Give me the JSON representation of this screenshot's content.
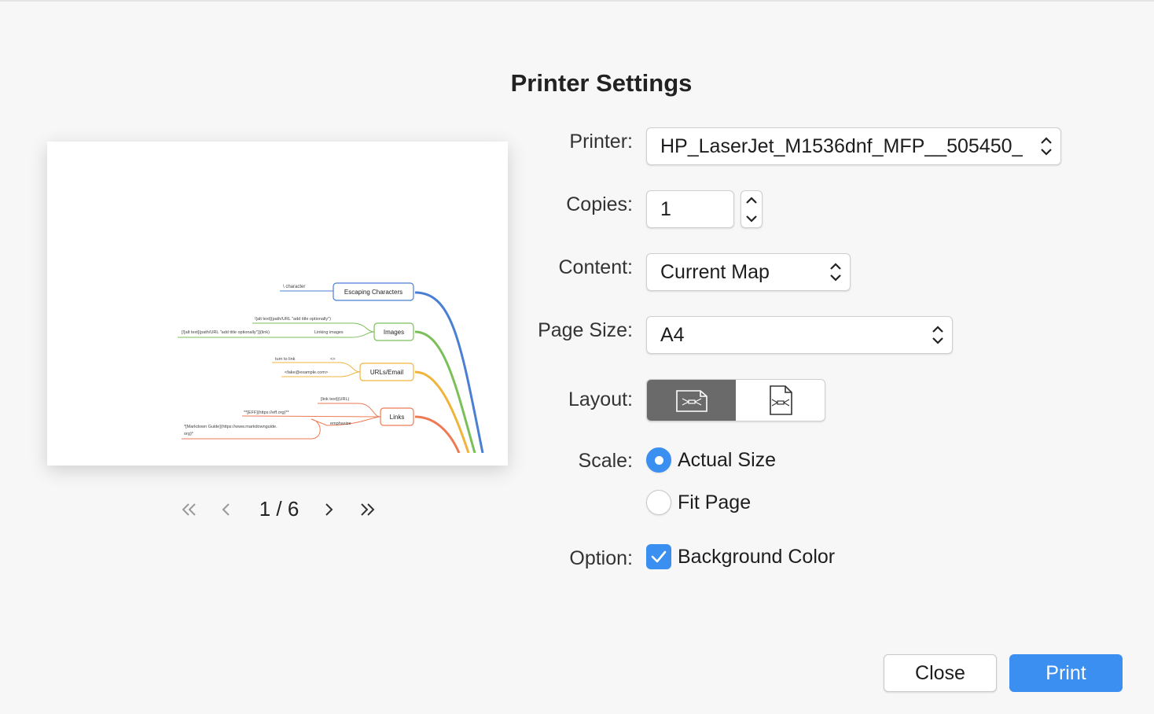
{
  "dialog": {
    "title": "Printer Settings"
  },
  "preview": {
    "nodes": {
      "escaping": "Escaping Characters",
      "images": "Images",
      "urls": "URLs/Email",
      "links": "Links"
    },
    "leaves": {
      "backslash": "\\ character",
      "img_alt": "![alt text](path/URL \"add title optionally\")",
      "img_link": "[![alt text](path/URL \"add title optionally\")](link)",
      "linking_images": "Linking images",
      "turn_to_link": "turn to link",
      "angle": "<>",
      "email": "<fake@example.com>",
      "link_text": "[link text](URL)",
      "eff": "**[EFF](https://eff.org)**",
      "emphasize": "emphasize",
      "md_guide_1": "*[Markdown Guide](https://www.markdownguide.",
      "md_guide_2": "org)*"
    },
    "colors": {
      "escaping": "#4a7fd4",
      "images": "#7bbf5a",
      "urls": "#f0b43c",
      "links": "#ee7a55"
    }
  },
  "pager": {
    "current": "1 / 6"
  },
  "form": {
    "printer": {
      "label": "Printer:",
      "value": "HP_LaserJet_M1536dnf_MFP__505450_"
    },
    "copies": {
      "label": "Copies:",
      "value": "1"
    },
    "content": {
      "label": "Content:",
      "value": "Current Map"
    },
    "page_size": {
      "label": "Page Size:",
      "value": "A4"
    },
    "layout": {
      "label": "Layout:",
      "selected": "landscape"
    },
    "scale": {
      "label": "Scale:",
      "options": [
        "Actual Size",
        "Fit Page"
      ],
      "selected": "Actual Size"
    },
    "option": {
      "label": "Option:",
      "background_color": "Background Color",
      "checked": true
    }
  },
  "buttons": {
    "close": "Close",
    "print": "Print"
  },
  "colors": {
    "accent": "#3b8ff0",
    "segment_active": "#6a6a6a"
  }
}
